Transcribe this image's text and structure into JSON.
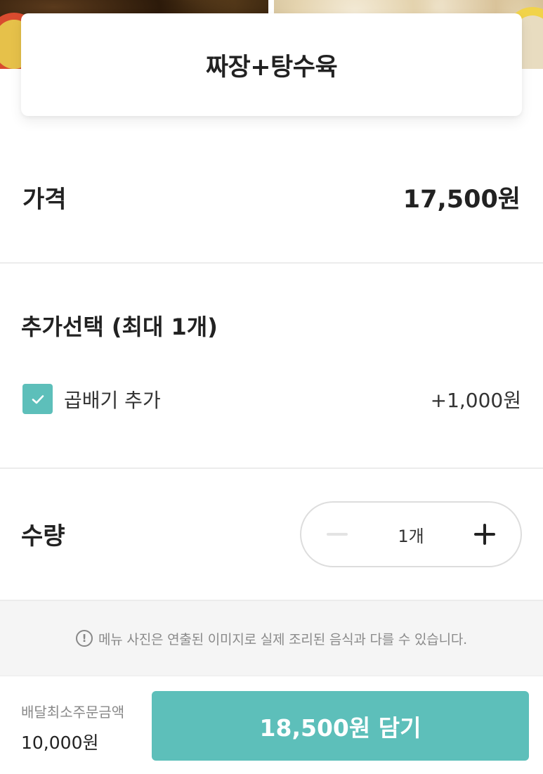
{
  "product": {
    "title": "짜장+탕수육"
  },
  "price": {
    "label": "가격",
    "value": "17,500원"
  },
  "options": {
    "title": "추가선택 (최대 1개)",
    "items": [
      {
        "label": "곱배기 추가",
        "price": "+1,000원",
        "checked": true
      }
    ]
  },
  "quantity": {
    "label": "수량",
    "value": "1개"
  },
  "notice": {
    "text": "메뉴 사진은 연출된 이미지로 실제 조리된 음식과 다를 수 있습니다."
  },
  "footer": {
    "min_order_label": "배달최소주문금액",
    "min_order_value": "10,000원",
    "cart_button_label": "18,500원 담기"
  },
  "colors": {
    "accent": "#5dbfba",
    "text": "#222222",
    "muted": "#8a8a8a"
  }
}
